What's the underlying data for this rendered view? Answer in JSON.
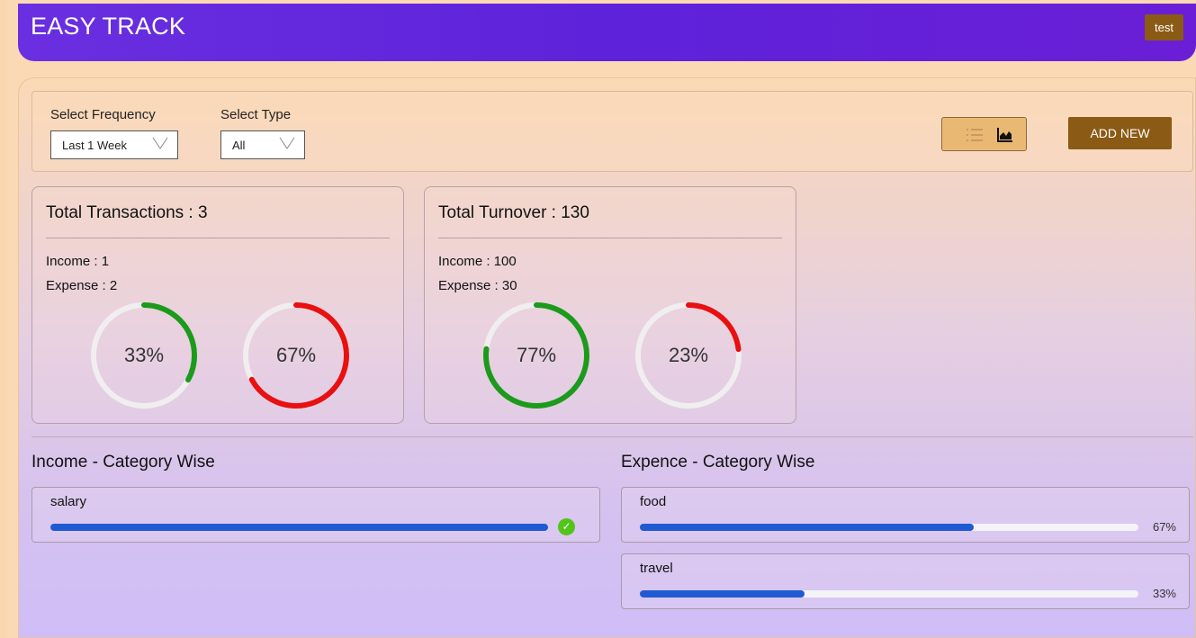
{
  "app": {
    "title": "EASY TRACK",
    "user_label": "test"
  },
  "filters": {
    "frequency_label": "Select Frequency",
    "frequency_value": "Last 1 Week",
    "type_label": "Select Type",
    "type_value": "All",
    "view_icons": [
      "list-icon",
      "area-chart-icon"
    ],
    "add_label": "ADD NEW"
  },
  "cards": [
    {
      "title": "Total Transactions : 3",
      "income": "Income : 1",
      "expense": "Expense : 2",
      "donuts": [
        {
          "label": "33%",
          "value": 33,
          "color": "#1b9a1b"
        },
        {
          "label": "67%",
          "value": 67,
          "color": "#e81010"
        }
      ]
    },
    {
      "title": "Total Turnover : 130",
      "income": "Income : 100",
      "expense": "Expense : 30",
      "donuts": [
        {
          "label": "77%",
          "value": 77,
          "color": "#1b9a1b"
        },
        {
          "label": "23%",
          "value": 23,
          "color": "#e81010"
        }
      ]
    }
  ],
  "income_section": {
    "title": "Income - Category Wise",
    "items": [
      {
        "name": "salary",
        "value": 100,
        "complete": true
      }
    ]
  },
  "expense_section": {
    "title": "Expence - Category Wise",
    "items": [
      {
        "name": "food",
        "value": 67,
        "label": "67%"
      },
      {
        "name": "travel",
        "value": 33,
        "label": "33%"
      }
    ]
  },
  "colors": {
    "header": "#5e22da",
    "button": "#8b5a14",
    "income": "#1b9a1b",
    "expense": "#e81010",
    "progress": "#1f5ad2"
  }
}
